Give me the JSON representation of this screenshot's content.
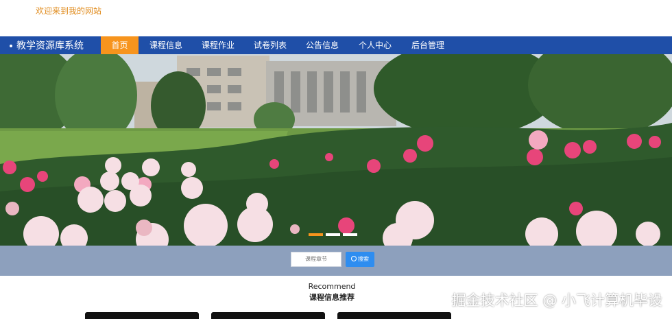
{
  "header": {
    "welcome": "欢迎来到我的网站"
  },
  "nav": {
    "brand": "教学资源库系统",
    "items": [
      {
        "label": "首页",
        "active": true
      },
      {
        "label": "课程信息"
      },
      {
        "label": "课程作业"
      },
      {
        "label": "试卷列表"
      },
      {
        "label": "公告信息"
      },
      {
        "label": "个人中心"
      },
      {
        "label": "后台管理"
      }
    ]
  },
  "carousel": {
    "slide_count": 3,
    "active_index": 0
  },
  "search": {
    "placeholder": "课程章节",
    "button_label": "搜索"
  },
  "recommend": {
    "title_en": "Recommend",
    "title_cn": "课程信息推荐"
  },
  "watermark": "掘金技术社区 @ 小飞计算机毕设",
  "colors": {
    "nav_bg": "#1f4fa8",
    "accent": "#f7941d",
    "welcome": "#e08a1a",
    "search_button": "#2e8df0",
    "search_band": "#8da0bd"
  }
}
